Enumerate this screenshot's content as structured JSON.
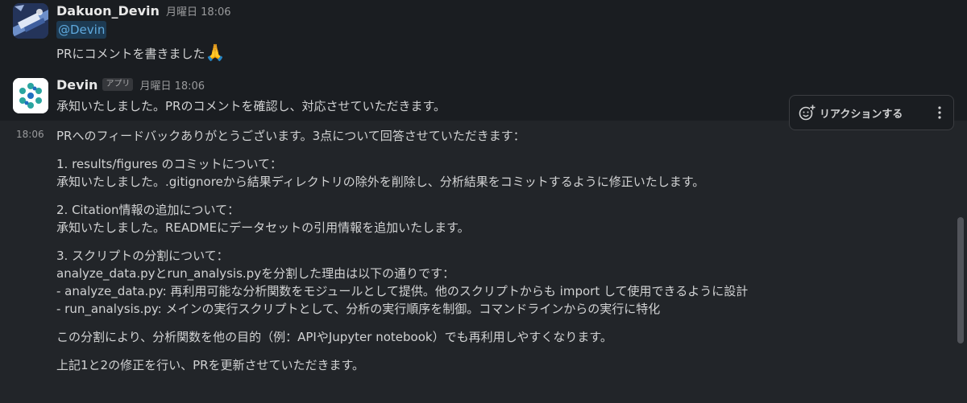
{
  "messages": [
    {
      "author": "Dakuon_Devin",
      "timestamp": "月曜日 18:06",
      "mention": "@Devin",
      "text": "PRにコメントを書きました",
      "emoji": "🙏"
    },
    {
      "author": "Devin",
      "app_badge": "アプリ",
      "timestamp": "月曜日 18:06",
      "text": "承知いたしました。PRのコメントを確認し、対応させていただきます。"
    },
    {
      "side_time": "18:06",
      "intro": "PRへのフィードバックありがとうございます。3点について回答させていただきます：",
      "item1_title": "1. results/figures のコミットについて：",
      "item1_body": "承知いたしました。.gitignoreから結果ディレクトリの除外を削除し、分析結果をコミットするように修正いたします。",
      "item2_title": "2. Citation情報の追加について：",
      "item2_body": "承知いたしました。READMEにデータセットの引用情報を追加いたします。",
      "item3_title": "3. スクリプトの分割について：",
      "item3_line1": "analyze_data.pyとrun_analysis.pyを分割した理由は以下の通りです：",
      "item3_line2": "- analyze_data.py: 再利用可能な分析関数をモジュールとして提供。他のスクリプトからも import して使用できるように設計",
      "item3_line3": "- run_analysis.py: メインの実行スクリプトとして、分析の実行順序を制御。コマンドラインからの実行に特化",
      "para_split": "この分割により、分析関数を他の目的（例：APIやJupyter notebook）でも再利用しやすくなります。",
      "para_update": "上記1と2の修正を行い、PRを更新させていただきます。"
    }
  ],
  "toolbar": {
    "reaction_label": "リアクションする",
    "reaction_icon": "add-reaction-icon",
    "more_icon": "more-vertical-icon"
  }
}
